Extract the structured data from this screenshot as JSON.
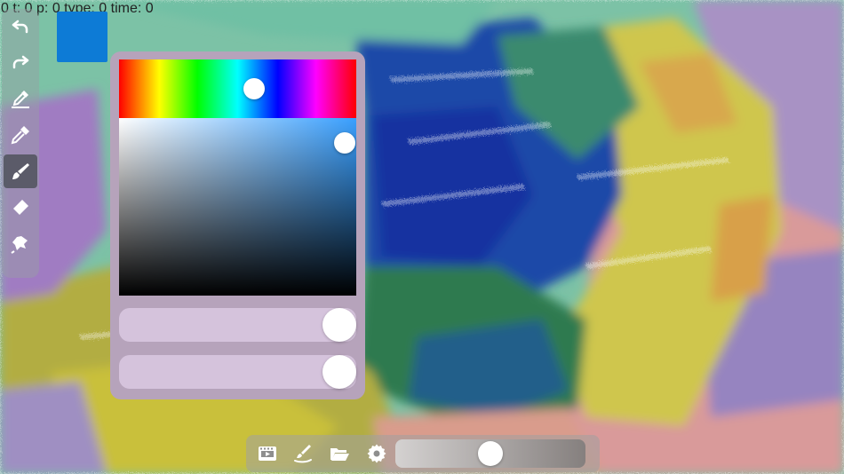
{
  "debug_text": "0 t: 0 p: 0 type: 0 time: 0",
  "colors": {
    "current_brush": "#0d7bd6",
    "hue_selected": "#3aa0ff",
    "panel": "#b6a3bb",
    "slider_track": "#d5c3dc",
    "toolbar_icon": "#ffffff"
  },
  "left_toolbar": {
    "tools": [
      {
        "name": "undo",
        "icon": "undo-icon",
        "active": false
      },
      {
        "name": "redo",
        "icon": "redo-icon",
        "active": false
      },
      {
        "name": "color-picker",
        "icon": "eyedropper-edit-icon",
        "active": false
      },
      {
        "name": "eyedropper",
        "icon": "eyedropper-icon",
        "active": false
      },
      {
        "name": "brush",
        "icon": "brush-icon",
        "active": true
      },
      {
        "name": "eraser",
        "icon": "eraser-icon",
        "active": false
      },
      {
        "name": "smudge",
        "icon": "smudge-icon",
        "active": false
      }
    ]
  },
  "color_picker": {
    "hue_position": 0.57,
    "saturation": 0.95,
    "value": 0.86,
    "opacity_slider": 0.93,
    "size_slider": 0.93
  },
  "bottom_toolbar": {
    "tools": [
      {
        "name": "film",
        "icon": "film-icon"
      },
      {
        "name": "paint-canvas",
        "icon": "paint-brush-stroke-icon"
      },
      {
        "name": "open",
        "icon": "folder-open-icon"
      },
      {
        "name": "settings",
        "icon": "gear-icon"
      }
    ],
    "brush_size_slider": 0.5
  }
}
